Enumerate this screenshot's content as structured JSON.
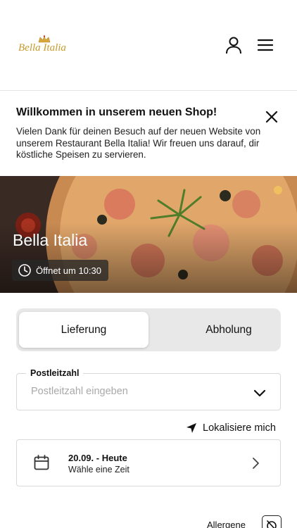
{
  "header": {
    "logo_text": "Bella Italia",
    "icons": {
      "user": "user-icon",
      "menu": "hamburger-menu-icon"
    }
  },
  "notice": {
    "title": "Willkommen in unserem neuen Shop!",
    "body": "Vielen Dank für deinen Besuch auf der neuen Website von unserem Restaurant Bella Italia! Wir freuen uns darauf, dir köstliche Speisen zu servieren.",
    "close_icon": "close-icon"
  },
  "hero": {
    "title": "Bella Italia",
    "opening_text": "Öffnet um 10:30",
    "clock_icon": "clock-icon"
  },
  "order_mode": {
    "options": [
      "Lieferung",
      "Abholung"
    ],
    "selected": "Lieferung"
  },
  "zip": {
    "label": "Postleitzahl",
    "placeholder": "Postleitzahl eingeben",
    "value": ""
  },
  "locate": {
    "label": "Lokalisiere mich",
    "icon": "location-arrow-icon"
  },
  "time_picker": {
    "date": "20.09. - Heute",
    "subtitle": "Wähle eine Zeit",
    "icon": "calendar-icon"
  },
  "allergens": {
    "label": "Allergene",
    "icon": "allergen-filter-icon"
  },
  "colors": {
    "accent_gold": "#c89a2a",
    "toggle_bg": "#e8e8e8",
    "border": "#d9d9d9"
  }
}
